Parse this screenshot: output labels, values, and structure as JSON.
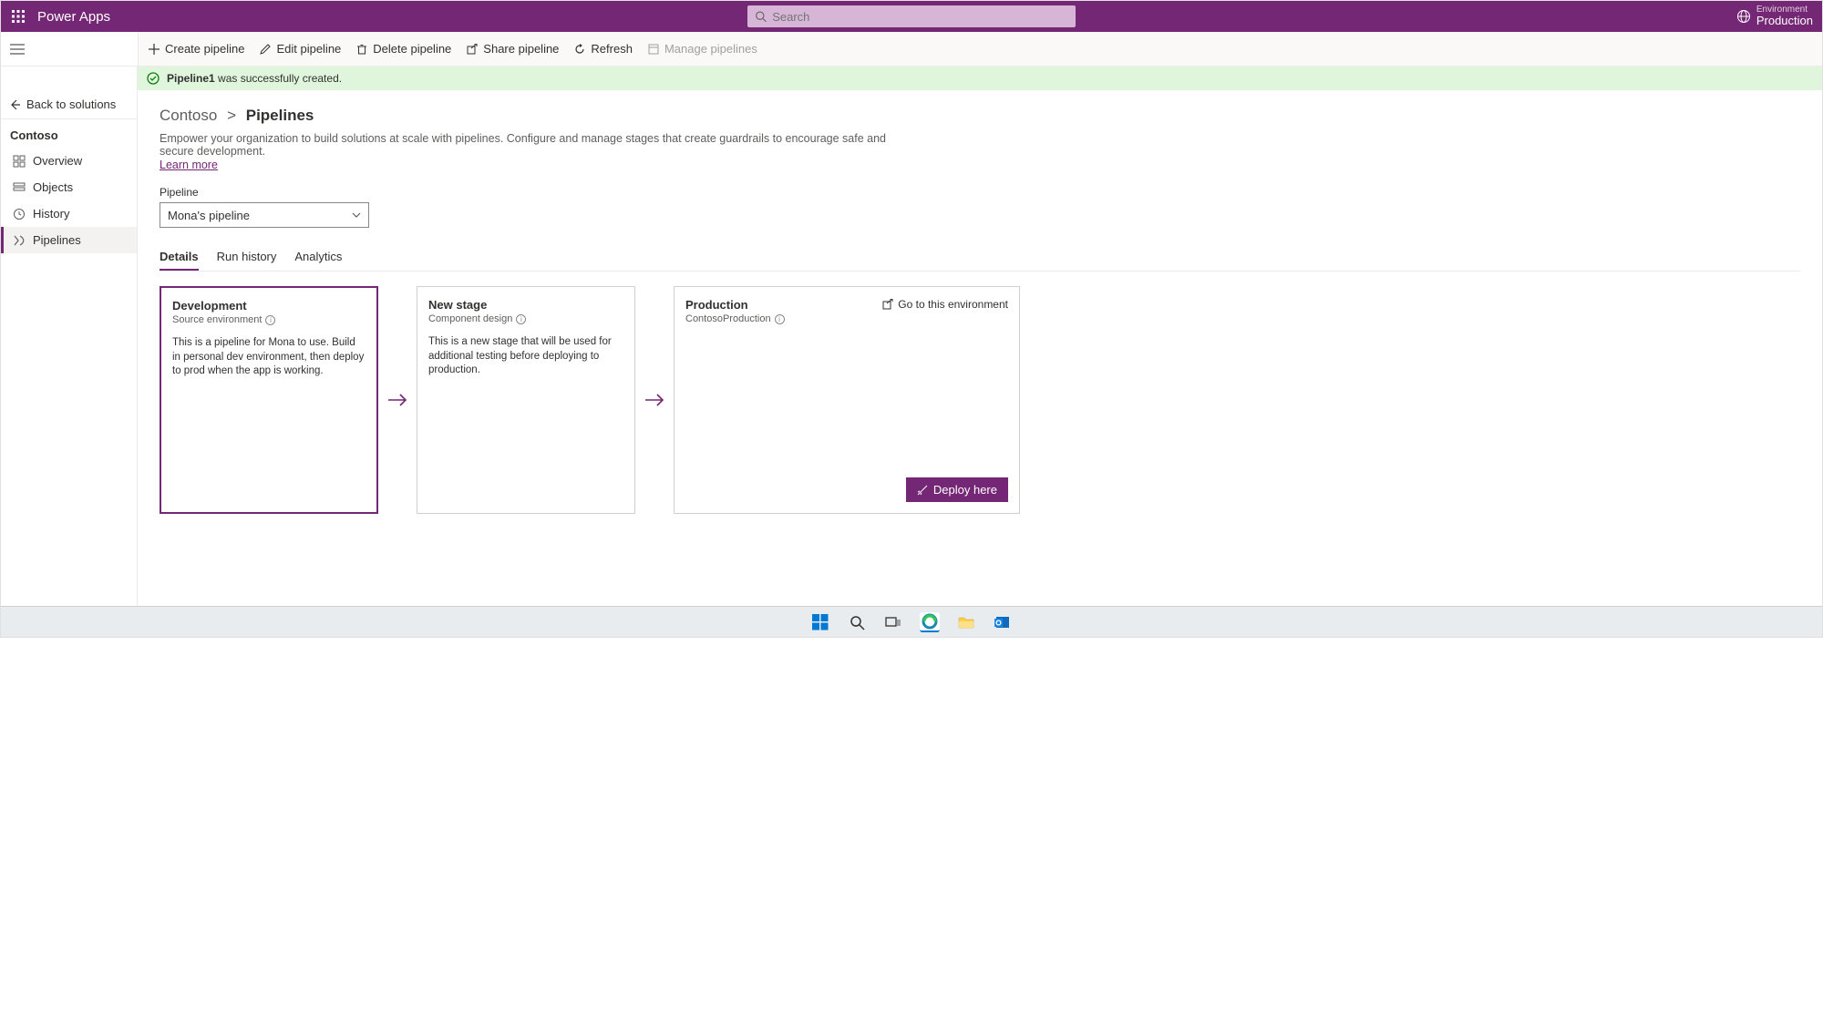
{
  "header": {
    "app_name": "Power Apps",
    "search_placeholder": "Search",
    "environment_label": "Environment",
    "environment_name": "Production"
  },
  "commands": {
    "create": "Create pipeline",
    "edit": "Edit pipeline",
    "delete": "Delete pipeline",
    "share": "Share pipeline",
    "refresh": "Refresh",
    "manage": "Manage pipelines"
  },
  "banner": {
    "bold": "Pipeline1",
    "rest": " was successfully created."
  },
  "sidebar": {
    "back": "Back to solutions",
    "solution": "Contoso",
    "items": [
      {
        "label": "Overview"
      },
      {
        "label": "Objects"
      },
      {
        "label": "History"
      },
      {
        "label": "Pipelines"
      }
    ]
  },
  "page": {
    "breadcrumb_root": "Contoso",
    "breadcrumb_leaf": "Pipelines",
    "description": "Empower your organization to build solutions at scale with pipelines. Configure and manage stages that create guardrails to encourage safe and secure development.",
    "learn_more": "Learn more",
    "pipeline_field_label": "Pipeline",
    "pipeline_selected": "Mona's pipeline",
    "tabs": [
      {
        "label": "Details"
      },
      {
        "label": "Run history"
      },
      {
        "label": "Analytics"
      }
    ],
    "stages": [
      {
        "title": "Development",
        "subtitle": "Source environment",
        "body": "This is a pipeline for Mona to use. Build in personal dev environment, then deploy to prod when the app is working."
      },
      {
        "title": "New stage",
        "subtitle": "Component design",
        "body": "This is a new stage that will be used for additional testing before deploying to production."
      },
      {
        "title": "Production",
        "subtitle": "ContosoProduction",
        "body": "",
        "goto": "Go to this environment",
        "deploy": "Deploy here"
      }
    ]
  },
  "taskbar": {
    "items": [
      "start",
      "search",
      "taskview",
      "edge",
      "explorer",
      "outlook"
    ]
  }
}
